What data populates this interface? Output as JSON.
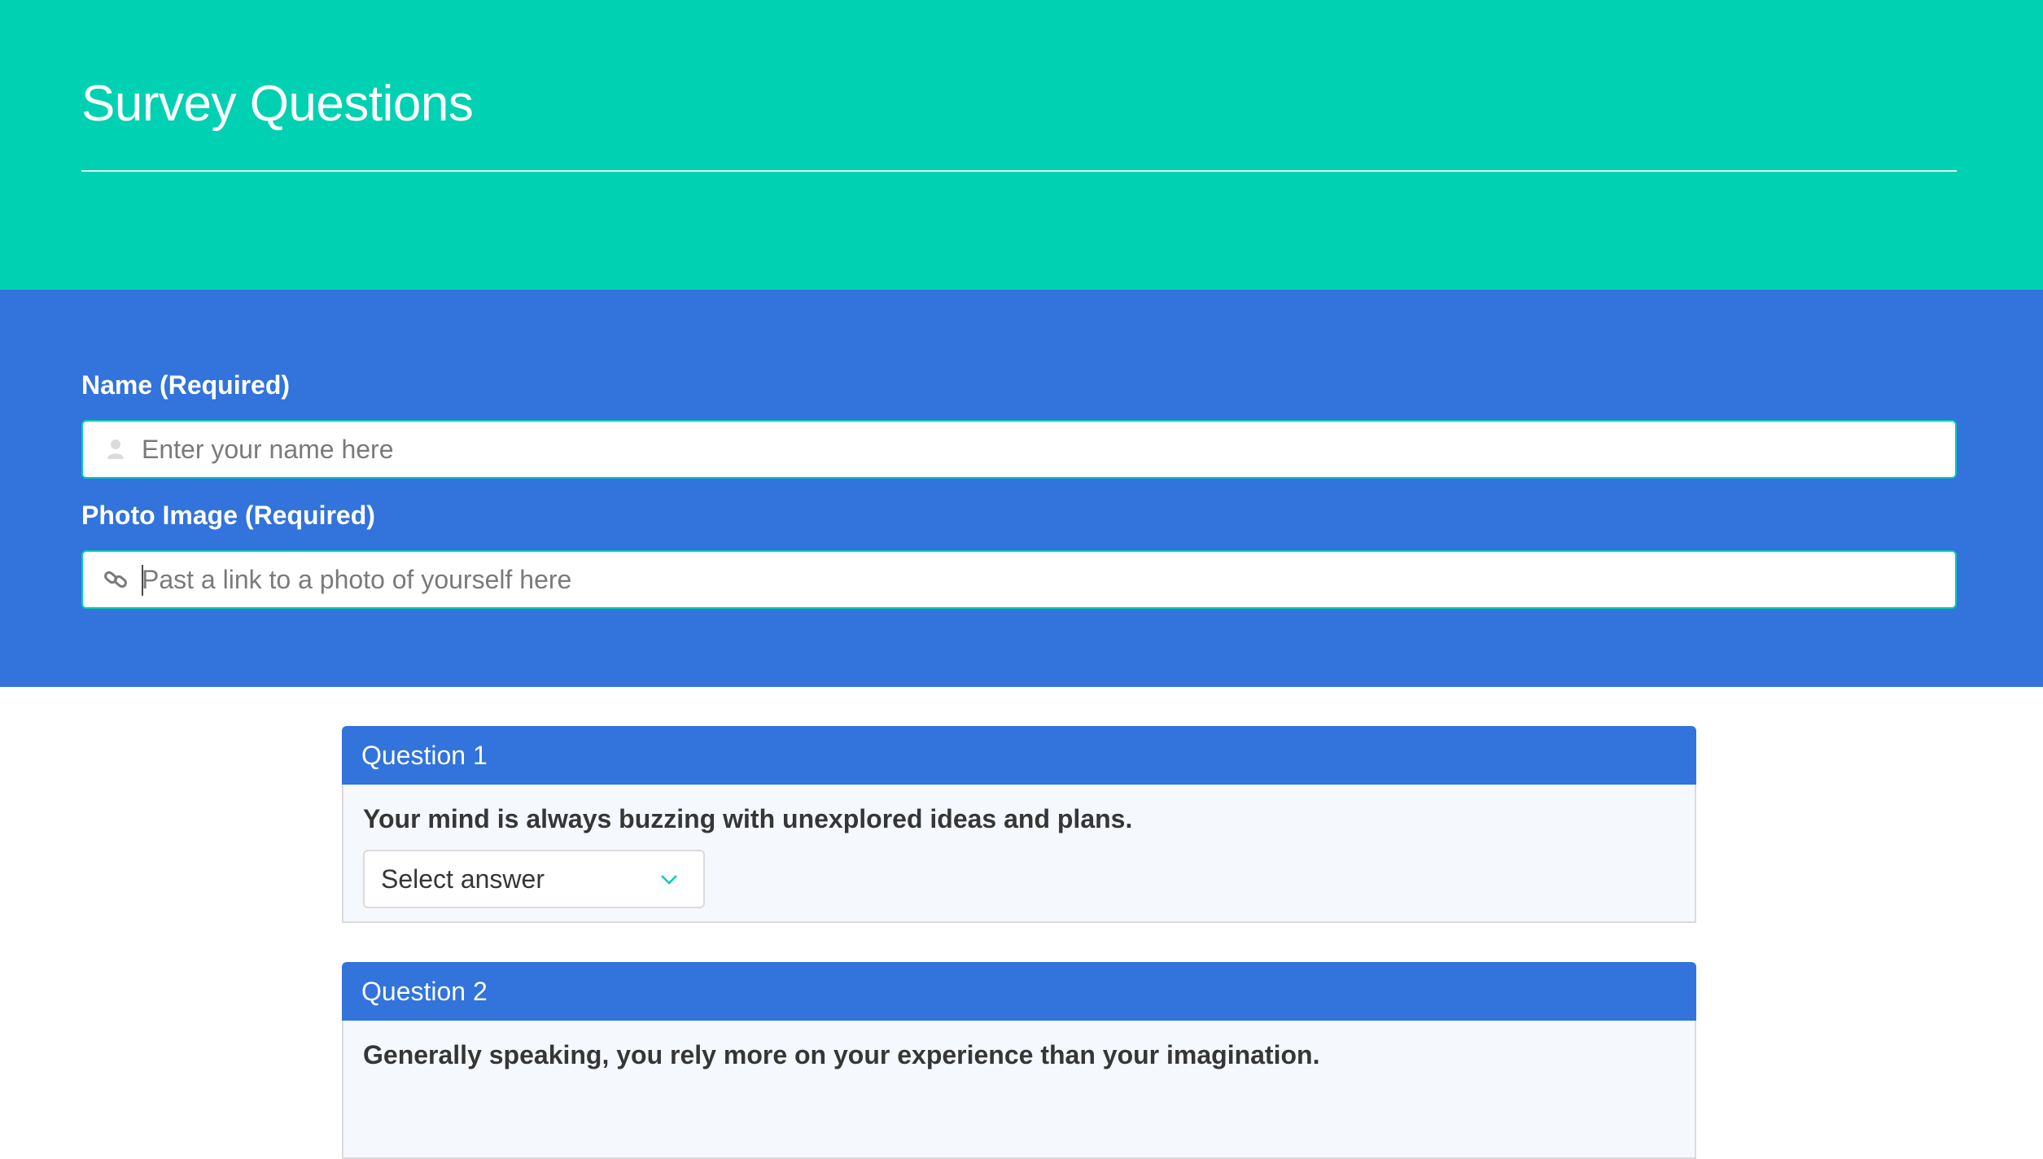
{
  "hero": {
    "title": "Survey Questions"
  },
  "form": {
    "name": {
      "label": "Name (Required)",
      "placeholder": "Enter your name here",
      "icon": "user-icon"
    },
    "photo": {
      "label": "Photo Image (Required)",
      "placeholder": "Past a link to a photo of yourself here",
      "icon": "link-icon"
    }
  },
  "questions": [
    {
      "header": "Question 1",
      "text": "Your mind is always buzzing with unexplored ideas and plans.",
      "select_value": "Select answer"
    },
    {
      "header": "Question 2",
      "text": "Generally speaking, you rely more on your experience than your imagination."
    }
  ],
  "colors": {
    "hero_bg": "#00d1b2",
    "form_bg": "#3273dc",
    "accent": "#00d1b2",
    "card_header": "#3273dc"
  }
}
